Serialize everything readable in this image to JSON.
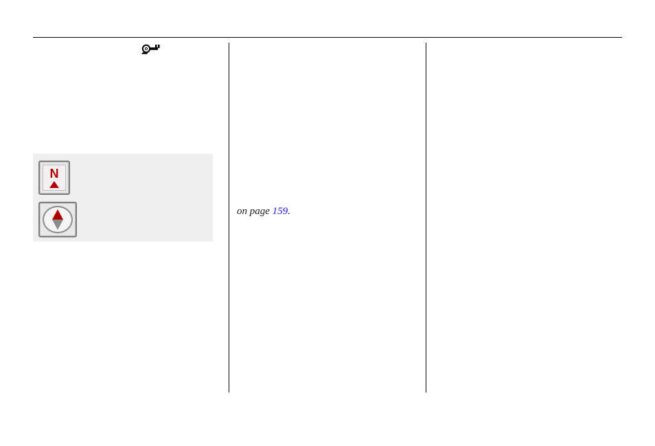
{
  "icons": {
    "key": "key-icon",
    "north_button": {
      "letter": "N"
    },
    "compass_button": "compass-icon"
  },
  "reference": {
    "prefix": "on page ",
    "page_number": "159",
    "suffix": "."
  }
}
